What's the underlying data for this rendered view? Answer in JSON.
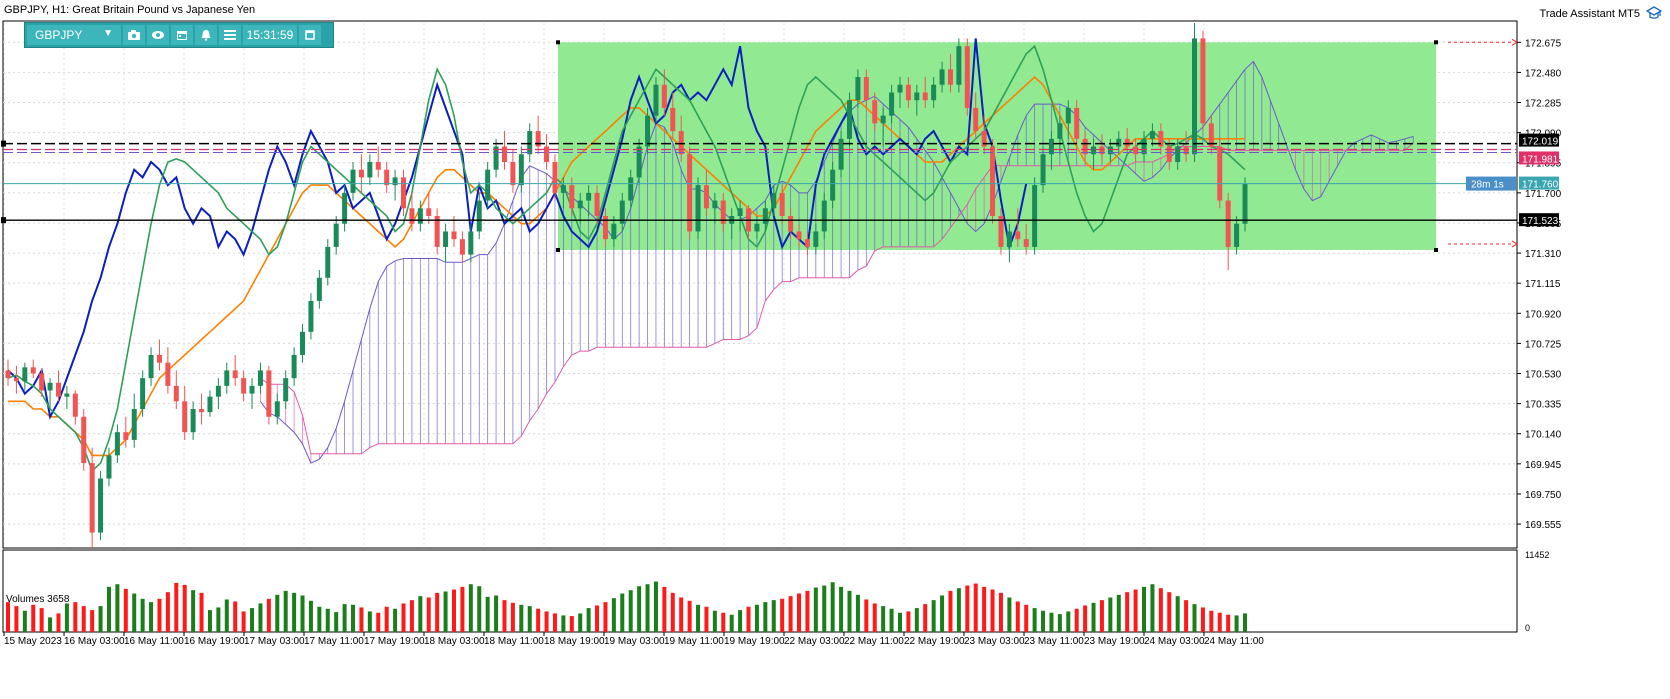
{
  "header": {
    "title": "GBPJPY, H1:  Great Britain Pound vs Japanese Yen",
    "plugin_label": "Trade Assistant MT5"
  },
  "toolbar": {
    "symbol": "GBPJPY",
    "time": "15:31:59",
    "icons": [
      "camera-icon",
      "eye-icon",
      "calendar-icon",
      "alarm-icon",
      "menu-icon",
      "window-icon"
    ]
  },
  "price_axis": {
    "ticks": [
      "172.675",
      "172.480",
      "172.285",
      "172.090",
      "171.895",
      "171.700",
      "171.505",
      "171.310",
      "171.115",
      "170.920",
      "170.725",
      "170.530",
      "170.335",
      "170.140",
      "169.945",
      "169.750",
      "169.555"
    ]
  },
  "price_labels": {
    "top_black": "172.019",
    "red_level": "171.981",
    "timer": "28m 1s",
    "current": "171.760",
    "black_level": "171.523"
  },
  "volume": {
    "label": "Volumes 3658",
    "axis_max": "11452",
    "axis_min": "0"
  },
  "time_axis": {
    "labels": [
      "15 May 2023",
      "16 May 03:00",
      "16 May 11:00",
      "16 May 19:00",
      "17 May 03:00",
      "17 May 11:00",
      "17 May 19:00",
      "18 May 03:00",
      "18 May 11:00",
      "18 May 19:00",
      "19 May 03:00",
      "19 May 11:00",
      "19 May 19:00",
      "22 May 03:00",
      "22 May 11:00",
      "22 May 19:00",
      "23 May 03:00",
      "23 May 11:00",
      "23 May 19:00",
      "24 May 03:00",
      "24 May 11:00"
    ]
  },
  "colors": {
    "bull": "#1a8a5a",
    "bear": "#f25454",
    "zone": "#8be88b",
    "tenkan": "#0b1fbf",
    "kijun": "#ff8000",
    "chikou": "#2ea05a",
    "span_a": "#6a5acd",
    "span_b": "#e05aa8",
    "vol_up": "#1a7f1a",
    "vol_down": "#ff1a1a"
  },
  "chart_data": {
    "type": "candlestick",
    "symbol": "GBPJPY",
    "timeframe": "H1",
    "y_range": [
      169.4,
      172.8
    ],
    "volume_range": [
      0,
      11452
    ],
    "candles": [
      [
        170.55,
        170.62,
        170.45,
        170.5
      ],
      [
        170.5,
        170.58,
        170.4,
        170.48
      ],
      [
        170.48,
        170.6,
        170.42,
        170.57
      ],
      [
        170.57,
        170.62,
        170.5,
        170.53
      ],
      [
        170.53,
        170.56,
        170.38,
        170.42
      ],
      [
        170.42,
        170.5,
        170.3,
        170.47
      ],
      [
        170.47,
        170.55,
        170.35,
        170.38
      ],
      [
        170.38,
        170.45,
        170.3,
        170.4
      ],
      [
        170.4,
        170.42,
        170.2,
        170.25
      ],
      [
        170.25,
        170.3,
        169.9,
        169.95
      ],
      [
        169.95,
        170.05,
        169.4,
        169.5
      ],
      [
        169.5,
        169.9,
        169.45,
        169.85
      ],
      [
        169.85,
        170.05,
        169.8,
        170.0
      ],
      [
        170.0,
        170.2,
        169.95,
        170.15
      ],
      [
        170.15,
        170.25,
        170.05,
        170.1
      ],
      [
        170.1,
        170.4,
        170.05,
        170.3
      ],
      [
        170.3,
        170.55,
        170.25,
        170.5
      ],
      [
        170.5,
        170.7,
        170.45,
        170.65
      ],
      [
        170.65,
        170.75,
        170.55,
        170.6
      ],
      [
        170.6,
        170.7,
        170.4,
        170.45
      ],
      [
        170.45,
        170.55,
        170.3,
        170.35
      ],
      [
        170.35,
        170.45,
        170.1,
        170.15
      ],
      [
        170.15,
        170.35,
        170.1,
        170.3
      ],
      [
        170.3,
        170.4,
        170.2,
        170.28
      ],
      [
        170.28,
        170.42,
        170.25,
        170.38
      ],
      [
        170.38,
        170.5,
        170.3,
        170.45
      ],
      [
        170.45,
        170.6,
        170.4,
        170.55
      ],
      [
        170.55,
        170.65,
        170.45,
        170.5
      ],
      [
        170.5,
        170.55,
        170.35,
        170.4
      ],
      [
        170.4,
        170.5,
        170.3,
        170.45
      ],
      [
        170.45,
        170.6,
        170.4,
        170.55
      ],
      [
        170.55,
        170.58,
        170.2,
        170.25
      ],
      [
        170.25,
        170.4,
        170.2,
        170.35
      ],
      [
        170.35,
        170.55,
        170.3,
        170.5
      ],
      [
        170.5,
        170.7,
        170.45,
        170.65
      ],
      [
        170.65,
        170.85,
        170.6,
        170.8
      ],
      [
        170.8,
        171.05,
        170.75,
        171.0
      ],
      [
        171.0,
        171.2,
        170.95,
        171.15
      ],
      [
        171.15,
        171.4,
        171.1,
        171.35
      ],
      [
        171.35,
        171.55,
        171.3,
        171.5
      ],
      [
        171.5,
        171.75,
        171.45,
        171.7
      ],
      [
        171.7,
        171.9,
        171.65,
        171.85
      ],
      [
        171.85,
        171.95,
        171.7,
        171.8
      ],
      [
        171.8,
        171.95,
        171.75,
        171.9
      ],
      [
        171.9,
        172.0,
        171.8,
        171.85
      ],
      [
        171.85,
        171.9,
        171.7,
        171.75
      ],
      [
        171.75,
        171.85,
        171.65,
        171.8
      ],
      [
        171.8,
        171.85,
        171.55,
        171.6
      ],
      [
        171.6,
        171.7,
        171.45,
        171.5
      ],
      [
        171.5,
        171.65,
        171.45,
        171.6
      ],
      [
        171.6,
        171.7,
        171.5,
        171.55
      ],
      [
        171.55,
        171.6,
        171.3,
        171.35
      ],
      [
        171.35,
        171.5,
        171.25,
        171.45
      ],
      [
        171.45,
        171.55,
        171.35,
        171.4
      ],
      [
        171.4,
        171.45,
        171.25,
        171.3
      ],
      [
        171.3,
        171.5,
        171.25,
        171.45
      ],
      [
        171.45,
        171.7,
        171.4,
        171.65
      ],
      [
        171.65,
        171.9,
        171.6,
        171.85
      ],
      [
        171.85,
        172.05,
        171.8,
        172.0
      ],
      [
        172.0,
        172.1,
        171.85,
        171.9
      ],
      [
        171.9,
        171.98,
        171.7,
        171.75
      ],
      [
        171.75,
        172.0,
        171.7,
        171.95
      ],
      [
        171.95,
        172.15,
        171.9,
        172.1
      ],
      [
        172.1,
        172.2,
        171.95,
        172.0
      ],
      [
        172.0,
        172.08,
        171.85,
        171.9
      ],
      [
        171.9,
        171.95,
        171.65,
        171.7
      ],
      [
        171.7,
        171.8,
        171.6,
        171.75
      ],
      [
        171.75,
        171.8,
        171.55,
        171.6
      ],
      [
        171.6,
        171.7,
        171.5,
        171.65
      ],
      [
        171.65,
        171.75,
        171.55,
        171.7
      ],
      [
        171.7,
        171.75,
        171.5,
        171.55
      ],
      [
        171.55,
        171.6,
        171.35,
        171.4
      ],
      [
        171.4,
        171.55,
        171.35,
        171.5
      ],
      [
        171.5,
        171.7,
        171.45,
        171.65
      ],
      [
        171.65,
        171.85,
        171.6,
        171.8
      ],
      [
        171.8,
        172.05,
        171.75,
        172.0
      ],
      [
        172.0,
        172.25,
        171.95,
        172.2
      ],
      [
        172.2,
        172.45,
        172.15,
        172.4
      ],
      [
        172.4,
        172.5,
        172.2,
        172.25
      ],
      [
        172.25,
        172.35,
        172.05,
        172.1
      ],
      [
        172.1,
        172.2,
        171.9,
        171.95
      ],
      [
        171.95,
        172.0,
        171.4,
        171.45
      ],
      [
        171.45,
        171.8,
        171.4,
        171.75
      ],
      [
        171.75,
        171.85,
        171.55,
        171.6
      ],
      [
        171.6,
        171.7,
        171.5,
        171.65
      ],
      [
        171.65,
        171.7,
        171.45,
        171.5
      ],
      [
        171.5,
        171.6,
        171.4,
        171.55
      ],
      [
        171.55,
        171.65,
        171.45,
        171.6
      ],
      [
        171.6,
        171.62,
        171.4,
        171.45
      ],
      [
        171.45,
        171.55,
        171.4,
        171.5
      ],
      [
        171.5,
        171.65,
        171.45,
        171.6
      ],
      [
        171.6,
        171.75,
        171.55,
        171.7
      ],
      [
        171.7,
        171.75,
        171.5,
        171.55
      ],
      [
        171.55,
        171.6,
        171.4,
        171.45
      ],
      [
        171.45,
        171.5,
        171.35,
        171.4
      ],
      [
        171.4,
        171.45,
        171.3,
        171.35
      ],
      [
        171.35,
        171.5,
        171.3,
        171.45
      ],
      [
        171.45,
        171.7,
        171.4,
        171.65
      ],
      [
        171.65,
        171.9,
        171.6,
        171.85
      ],
      [
        171.85,
        172.1,
        171.8,
        172.05
      ],
      [
        172.05,
        172.35,
        172.0,
        172.3
      ],
      [
        172.3,
        172.5,
        172.25,
        172.45
      ],
      [
        172.45,
        172.5,
        172.25,
        172.3
      ],
      [
        172.3,
        172.35,
        172.1,
        172.15
      ],
      [
        172.15,
        172.25,
        172.0,
        172.2
      ],
      [
        172.2,
        172.4,
        172.15,
        172.35
      ],
      [
        172.35,
        172.45,
        172.25,
        172.4
      ],
      [
        172.4,
        172.45,
        172.25,
        172.3
      ],
      [
        172.3,
        172.4,
        172.2,
        172.35
      ],
      [
        172.35,
        172.45,
        172.25,
        172.3
      ],
      [
        172.3,
        172.45,
        172.25,
        172.4
      ],
      [
        172.4,
        172.55,
        172.35,
        172.5
      ],
      [
        172.5,
        172.6,
        172.35,
        172.4
      ],
      [
        172.4,
        172.7,
        172.35,
        172.65
      ],
      [
        172.65,
        172.7,
        172.2,
        172.25
      ],
      [
        172.25,
        172.35,
        172.05,
        172.1
      ],
      [
        172.1,
        172.2,
        171.95,
        172.0
      ],
      [
        172.0,
        172.05,
        171.5,
        171.55
      ],
      [
        171.55,
        171.6,
        171.3,
        171.35
      ],
      [
        171.35,
        171.5,
        171.25,
        171.45
      ],
      [
        171.45,
        171.6,
        171.35,
        171.4
      ],
      [
        171.4,
        171.5,
        171.3,
        171.35
      ],
      [
        171.35,
        171.8,
        171.3,
        171.75
      ],
      [
        171.75,
        172.0,
        171.7,
        171.95
      ],
      [
        171.95,
        172.1,
        171.85,
        172.05
      ],
      [
        172.05,
        172.2,
        171.95,
        172.15
      ],
      [
        172.15,
        172.3,
        172.05,
        172.25
      ],
      [
        172.25,
        172.3,
        172.0,
        172.05
      ],
      [
        172.05,
        172.1,
        171.9,
        171.95
      ],
      [
        171.95,
        172.05,
        171.85,
        172.0
      ],
      [
        172.0,
        172.08,
        171.9,
        171.95
      ],
      [
        171.95,
        172.05,
        171.9,
        172.0
      ],
      [
        172.0,
        172.1,
        171.95,
        172.05
      ],
      [
        172.05,
        172.12,
        171.95,
        172.0
      ],
      [
        172.0,
        172.05,
        171.9,
        171.95
      ],
      [
        171.95,
        172.1,
        171.9,
        172.05
      ],
      [
        172.05,
        172.15,
        172.0,
        172.1
      ],
      [
        172.1,
        172.15,
        171.95,
        172.0
      ],
      [
        172.0,
        172.05,
        171.85,
        171.9
      ],
      [
        171.9,
        172.05,
        171.85,
        172.0
      ],
      [
        172.0,
        172.1,
        171.9,
        171.95
      ],
      [
        171.95,
        172.8,
        171.9,
        172.7
      ],
      [
        172.7,
        172.75,
        172.1,
        172.15
      ],
      [
        172.15,
        172.2,
        171.95,
        172.0
      ],
      [
        172.0,
        172.05,
        171.6,
        171.65
      ],
      [
        171.65,
        171.7,
        171.2,
        171.35
      ],
      [
        171.35,
        171.55,
        171.3,
        171.5
      ],
      [
        171.5,
        171.8,
        171.45,
        171.76
      ]
    ],
    "tenkan": [
      170.5,
      170.52,
      170.48,
      170.45,
      170.4,
      170.3,
      170.25,
      170.2,
      170.15,
      170.05,
      169.9,
      169.95,
      170.1,
      170.3,
      170.6,
      170.9,
      171.2,
      171.5,
      171.75,
      171.9,
      171.92,
      171.9,
      171.85,
      171.8,
      171.75,
      171.7,
      171.6,
      171.55,
      171.5,
      171.45,
      171.4,
      171.3,
      171.35,
      171.5,
      171.7,
      171.9,
      172.0,
      171.95,
      171.9,
      171.85,
      171.8,
      171.75,
      171.7,
      171.65,
      171.6,
      171.55,
      171.45,
      171.5,
      171.7,
      172.0,
      172.3,
      172.5,
      172.4,
      172.2,
      171.9,
      171.7,
      171.75,
      171.7,
      171.6,
      171.55,
      171.5,
      171.55,
      171.6,
      171.65,
      171.7,
      171.8,
      171.75,
      171.6,
      171.45,
      171.4,
      171.5,
      171.7,
      171.9,
      172.1,
      172.2,
      172.3,
      172.4,
      172.5,
      172.45,
      172.4,
      172.35,
      172.3,
      172.2,
      172.1,
      172.0,
      171.85,
      171.7,
      171.55,
      171.4,
      171.35,
      171.45,
      171.65,
      171.85,
      172.05,
      172.25,
      172.4,
      172.45,
      172.4,
      172.35,
      172.3,
      172.2,
      172.1,
      172.0,
      171.95,
      171.9,
      171.85,
      171.8,
      171.75,
      171.7,
      171.65,
      171.7,
      171.8,
      171.9,
      171.95,
      172.0,
      172.05,
      172.1,
      172.2,
      172.3,
      172.4,
      172.5,
      172.6,
      172.65,
      172.5,
      172.3,
      172.1,
      171.9,
      171.7,
      171.55,
      171.45,
      171.5,
      171.65,
      171.8,
      171.95,
      172.0,
      172.05,
      172.1,
      172.05,
      172.0,
      172.02,
      172.05,
      172.08,
      172.05,
      172.0,
      171.98,
      171.95,
      171.9,
      171.85,
      171.8,
      171.76,
      171.76,
      171.76
    ],
    "kijun": [
      170.35,
      170.35,
      170.35,
      170.3,
      170.3,
      170.25,
      170.25,
      170.2,
      170.15,
      170.1,
      170.0,
      170.0,
      170.0,
      170.05,
      170.1,
      170.2,
      170.3,
      170.4,
      170.5,
      170.55,
      170.6,
      170.65,
      170.7,
      170.75,
      170.8,
      170.85,
      170.9,
      170.95,
      171.0,
      171.1,
      171.2,
      171.3,
      171.4,
      171.5,
      171.6,
      171.7,
      171.75,
      171.75,
      171.75,
      171.7,
      171.65,
      171.6,
      171.55,
      171.5,
      171.45,
      171.4,
      171.35,
      171.4,
      171.5,
      171.6,
      171.7,
      171.8,
      171.85,
      171.85,
      171.8,
      171.75,
      171.7,
      171.7,
      171.65,
      171.6,
      171.55,
      171.5,
      171.5,
      171.55,
      171.6,
      171.7,
      171.8,
      171.9,
      171.95,
      172.0,
      172.05,
      172.1,
      172.15,
      172.2,
      172.25,
      172.25,
      172.2,
      172.15,
      172.1,
      172.05,
      172.0,
      171.95,
      171.9,
      171.85,
      171.8,
      171.75,
      171.7,
      171.65,
      171.6,
      171.55,
      171.55,
      171.6,
      171.7,
      171.8,
      171.9,
      172.0,
      172.1,
      172.15,
      172.2,
      172.25,
      172.3,
      172.3,
      172.25,
      172.2,
      172.15,
      172.1,
      172.05,
      172.0,
      171.95,
      171.9,
      171.9,
      171.9,
      171.95,
      172.0,
      172.05,
      172.1,
      172.15,
      172.2,
      172.25,
      172.3,
      172.35,
      172.4,
      172.45,
      172.4,
      172.3,
      172.2,
      172.1,
      172.0,
      171.9,
      171.85,
      171.85,
      171.9,
      171.95,
      172.0,
      172.05,
      172.05,
      172.05,
      172.05,
      172.05,
      172.05,
      172.05,
      172.05,
      172.05,
      172.05,
      172.05,
      172.05,
      172.05,
      172.05,
      172.05,
      172.05
    ],
    "volumes": [
      4500,
      3900,
      3200,
      4100,
      3600,
      2200,
      2800,
      4300,
      4500,
      3900,
      3300,
      3900,
      6800,
      7200,
      6500,
      5800,
      5000,
      4500,
      5000,
      6000,
      7400,
      7100,
      6300,
      5900,
      3300,
      3700,
      4900,
      4600,
      3100,
      3600,
      4300,
      5000,
      5600,
      6200,
      5900,
      5500,
      4700,
      3800,
      3500,
      3000,
      4200,
      4100,
      3700,
      3100,
      2900,
      3800,
      3500,
      4300,
      4800,
      5400,
      5200,
      5900,
      6100,
      6400,
      6800,
      7200,
      6900,
      5300,
      5500,
      4800,
      4400,
      4100,
      3900,
      3500,
      3100,
      2800,
      2500,
      2400,
      2800,
      3600,
      4000,
      4500,
      5100,
      5800,
      6300,
      6900,
      7200,
      7600,
      6800,
      5900,
      5200,
      4700,
      4100,
      3800,
      3200,
      2900,
      2600,
      3300,
      3800,
      4100,
      4500,
      4800,
      5000,
      5400,
      5800,
      6200,
      6700,
      7000,
      7500,
      6800,
      6200,
      5600,
      4900,
      4300,
      3900,
      3500,
      2900,
      3100,
      3600,
      4200,
      4800,
      5500,
      6200,
      6600,
      7000,
      7300,
      6800,
      6400,
      5900,
      5200,
      4600,
      4100,
      3600,
      3200,
      2900,
      2700,
      3100,
      3500,
      4000,
      4400,
      4800,
      5200,
      5600,
      6000,
      6400,
      6800,
      7200,
      6600,
      6000,
      5400,
      4800,
      4200,
      3700,
      3200,
      2900,
      2600,
      2500,
      2800,
      3100,
      3400,
      3600,
      3800,
      4000
    ],
    "zone": {
      "y_top": 172.675,
      "y_bottom": 171.33
    },
    "levels": {
      "black_dashed": 172.019,
      "red_dashed": 171.981,
      "current": 171.76,
      "black_solid": 171.523
    }
  }
}
